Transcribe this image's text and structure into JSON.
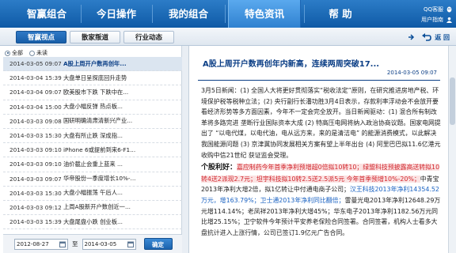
{
  "nav": {
    "items": [
      "智赢组合",
      "今日操作",
      "我的组合",
      "特色资讯",
      "帮 助"
    ],
    "active_index": 3,
    "links": {
      "qq": "QQ客服",
      "user": "用户指南"
    }
  },
  "subnav": {
    "tabs": [
      "智赢视点",
      "散家叛道",
      "行业动态"
    ],
    "active_index": 0,
    "back_label": "返 回"
  },
  "filter": {
    "all": "全部",
    "unread": "未读",
    "selected": "all"
  },
  "list": [
    {
      "time": "2014-03-05 09:07",
      "title": "A股上周开户数再创年...",
      "selected": true
    },
    {
      "time": "2014-03-04 15:39",
      "title": "大盘单日呈探底回升走势"
    },
    {
      "time": "2014-03-04 09:07",
      "title": "欧美股市下跌  下跌中在..."
    },
    {
      "time": "2014-03-04 15:00",
      "title": "大盘小幅反弹      热点板..."
    },
    {
      "time": "2014-03-03 09:08",
      "title": "国研明确清肃清新兴产业..."
    },
    {
      "time": "2014-03-03 15:30",
      "title": "大盘有所止跌      深成指..."
    },
    {
      "time": "2014-03-03 09:10",
      "title": "iPhone 6或提前到来6-F1..."
    },
    {
      "time": "2014-03-03 09:10",
      "title": "油价截止会重上蓝来    ..."
    },
    {
      "time": "2014-03-03 09:07",
      "title": "华帝股份一季度增长10%-..."
    },
    {
      "time": "2014-03-03 15:30",
      "title": "大盘小幅振荡      午后人..."
    },
    {
      "time": "2014-03-03 09:12",
      "title": "上周A股新开户数创近一..."
    },
    {
      "time": "2014-03-03 15:39",
      "title": "大盘尾盘小跌      创业板..."
    }
  ],
  "dates": {
    "from": "2012-08-27",
    "to_label": "至",
    "to": "2014-03-05",
    "confirm": "确定"
  },
  "article": {
    "title": "A股上周开户数再创年内新高，连续两周突破17...",
    "date": "2014-03-05 09:07",
    "para1": "3月5日新闻：(1) 全国人大将更好贯彻落实“税收法定”原则，在研究推进房地产税、环境保护税等税种立法；(2) 央行副行长潘功胜3月4日表示，存款利率浮动会不会放开要看经济形势等多方面因素，今年不一定会完全放开。当日新闻驱动：(1) 混合所有制改革将多路完进  垄断行业国际资本大成 (2) 特高压电网将纳入政治协商议题。国家电网提出了 “以电代煤，以电代油，电从远方来，来的是清洁电” 的能源消费模式，以此解决我国能源问题 (3) 京津冀协同发展相关方案有望上半年出台 (4) 阿里巴巴拟11.6亿港元收购中信21世纪 获证监会受理。",
    "hl_label": "个股利好：",
    "hl_red": "嘉应制药今年首季净利预增超0倍拟10转10；绿盟科技预披露高送转拟10转4送2派现2.7元；坦宇科技拟10转2.5送2.5派5元 今年首季预增10%-20%；",
    "hl_blue1": "中青宝2013年净利大增2倍，拟1亿转让中付通电商子公司；",
    "hl_blue2": "汉王科技2013年净利14354.52万元，增163.79%；卫士通2013年净利同比翻倍；",
    "hl_blue3": "雷曼光电2013年净利12648.29万元增114.14%；老凤祥2013年净利大增45%；华东电子2013年净利1182.56万元同比增25.15%；卫宁软件今年预计平安养老保险合同签署。",
    "hl_tail": "合同签署，机构人士看多大盘抗计进入上涨行情，公司已签订1.9亿元广告合同。"
  }
}
